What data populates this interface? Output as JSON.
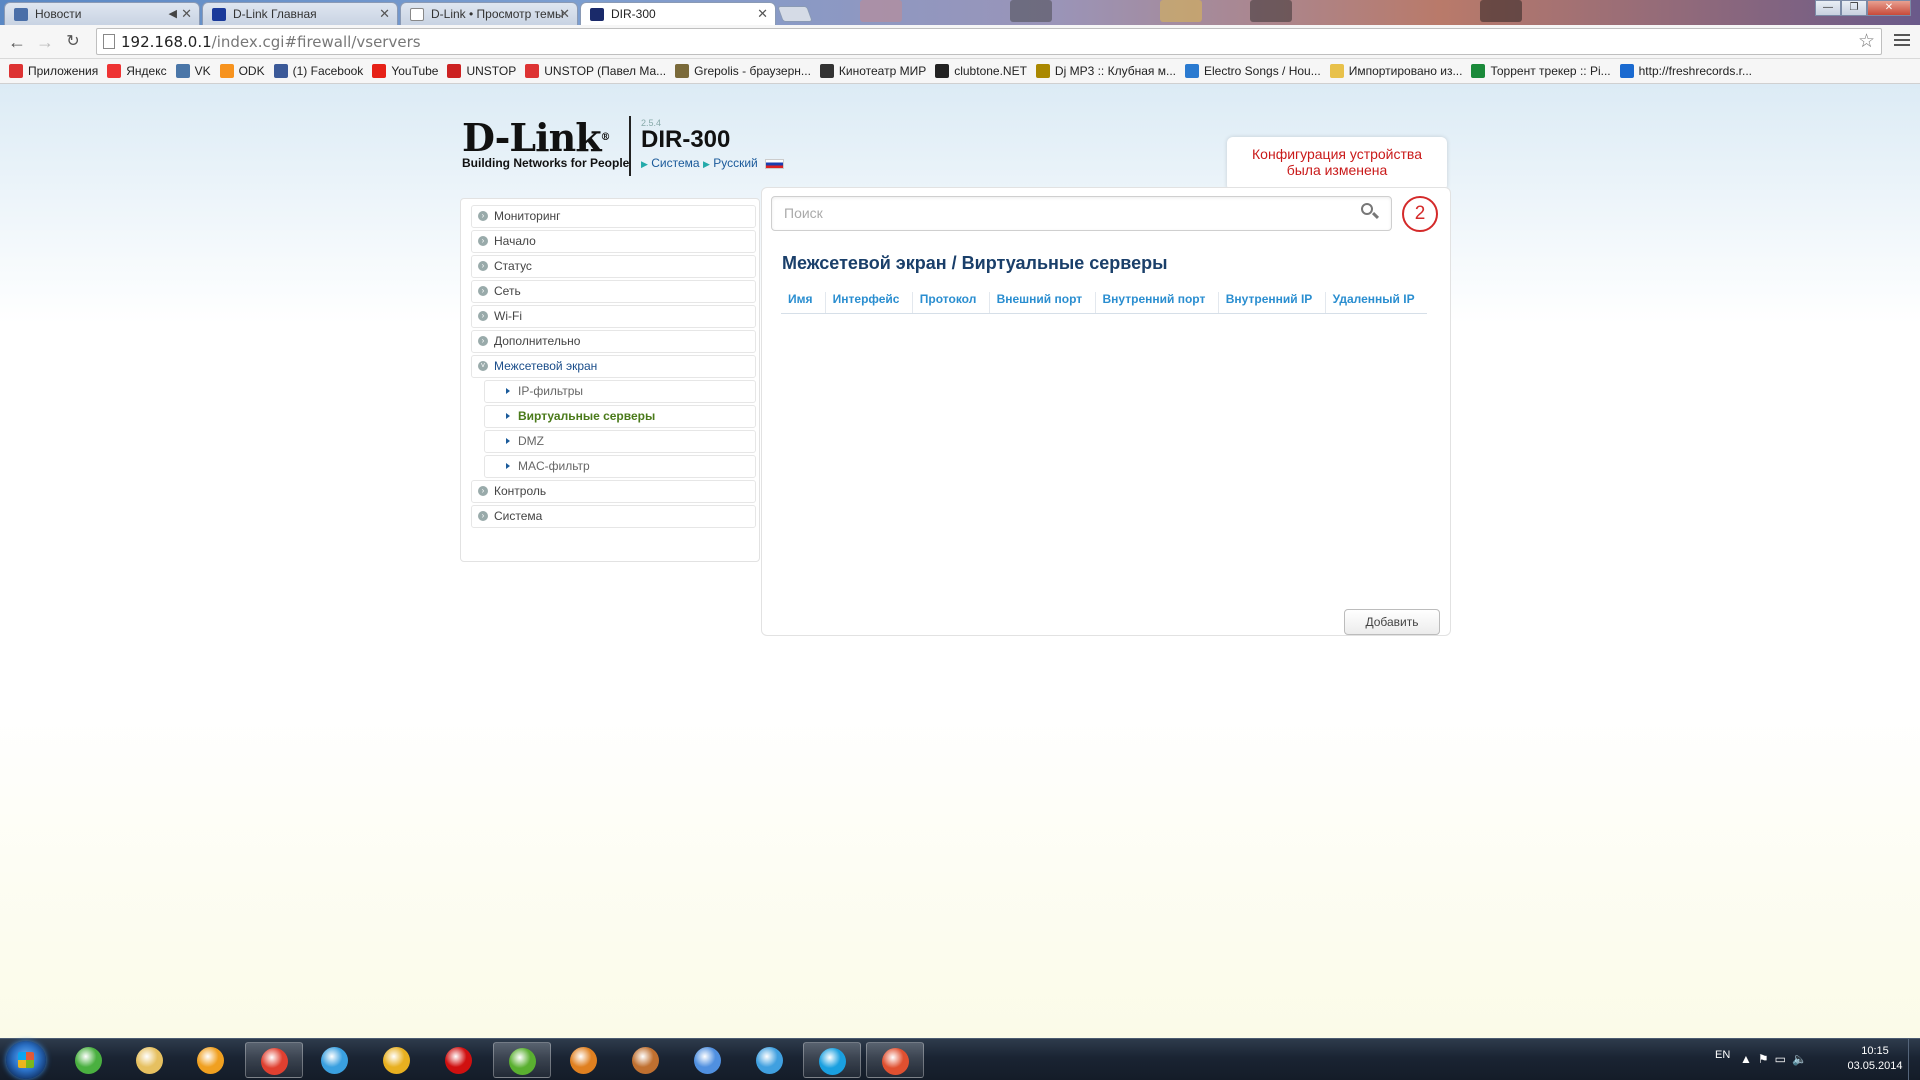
{
  "browser": {
    "tabs": [
      {
        "title": "Новости",
        "muted": true,
        "active": false
      },
      {
        "title": "D-Link Главная",
        "active": false
      },
      {
        "title": "D-Link • Просмотр темы",
        "active": false
      },
      {
        "title": "DIR-300",
        "active": true
      }
    ],
    "window_controls": [
      "—",
      "❐",
      "✕"
    ],
    "url_host": "192.168.0.1",
    "url_path": "/index.cgi#firewall/vservers",
    "bookmarks": [
      {
        "label": "Приложения",
        "icon": "apps-grid-icon",
        "color": "#d33"
      },
      {
        "label": "Яндекс",
        "icon": "yandex-icon",
        "color": "#e33"
      },
      {
        "label": "VK",
        "icon": "vk-icon",
        "color": "#4a76a8"
      },
      {
        "label": "ODK",
        "icon": "odnoklassniki-icon",
        "color": "#f7931e"
      },
      {
        "label": "(1) Facebook",
        "icon": "facebook-icon",
        "color": "#3b5998"
      },
      {
        "label": "YouTube",
        "icon": "youtube-icon",
        "color": "#e62117"
      },
      {
        "label": "UNSTOP",
        "icon": "unstop-icon",
        "color": "#c22"
      },
      {
        "label": "UNSTOP (Павел Ма...",
        "icon": "unstop-s-icon",
        "color": "#d33"
      },
      {
        "label": "Grepolis - браузерн...",
        "icon": "grepolis-icon",
        "color": "#7a6a3a"
      },
      {
        "label": "Кинотеатр МИР",
        "icon": "cinema-icon",
        "color": "#333"
      },
      {
        "label": "clubtone.NET",
        "icon": "clubtone-icon",
        "color": "#222"
      },
      {
        "label": "Dj MP3 :: Клубная м...",
        "icon": "djmp3-icon",
        "color": "#a80"
      },
      {
        "label": "Electro Songs / Hou...",
        "icon": "electro-icon",
        "color": "#2a7ad0"
      },
      {
        "label": "Импортировано из...",
        "icon": "folder-icon",
        "color": "#e8c14a"
      },
      {
        "label": "Торрент трекер :: Pi...",
        "icon": "torrent-icon",
        "color": "#1a8a3a"
      },
      {
        "label": "http://freshrecords.r...",
        "icon": "ie-icon",
        "color": "#1a6ad0"
      }
    ]
  },
  "header": {
    "brand": "D-Link",
    "tagline": "Building Networks for People",
    "firmware": "2.5.4",
    "model": "DIR-300",
    "link_system": "Система",
    "link_language": "Русский"
  },
  "notice": {
    "line1": "Конфигурация устройства",
    "line2": "была изменена",
    "count": "2"
  },
  "search": {
    "placeholder": "Поиск"
  },
  "sidebar": {
    "items": [
      {
        "label": "Мониторинг",
        "type": "top"
      },
      {
        "label": "Начало",
        "type": "top"
      },
      {
        "label": "Статус",
        "type": "top"
      },
      {
        "label": "Сеть",
        "type": "top"
      },
      {
        "label": "Wi-Fi",
        "type": "top"
      },
      {
        "label": "Дополнительно",
        "type": "top"
      },
      {
        "label": "Межсетевой экран",
        "type": "open"
      },
      {
        "label": "IP-фильтры",
        "type": "sub"
      },
      {
        "label": "Виртуальные серверы",
        "type": "sub-active"
      },
      {
        "label": "DMZ",
        "type": "sub"
      },
      {
        "label": "MAC-фильтр",
        "type": "sub"
      },
      {
        "label": "Контроль",
        "type": "top"
      },
      {
        "label": "Система",
        "type": "top"
      }
    ]
  },
  "main": {
    "breadcrumb_parent": "Межсетевой экран",
    "breadcrumb_sep": "/",
    "title": "Виртуальные серверы",
    "columns": [
      "Имя",
      "Интерфейс",
      "Протокол",
      "Внешний порт",
      "Внутренний порт",
      "Внутренний IP",
      "Удаленный IP"
    ],
    "rows": [],
    "add_button": "Добавить"
  },
  "taskbar": {
    "apps": [
      {
        "name": "butterfly-app-icon",
        "color": "#4ab040",
        "active": false
      },
      {
        "name": "explorer-folder-icon",
        "color": "#e6c060",
        "active": false
      },
      {
        "name": "aimp-icon",
        "color": "#f0a020",
        "active": false
      },
      {
        "name": "chrome-icon",
        "color": "#e04030",
        "active": true
      },
      {
        "name": "music-player-icon",
        "color": "#3aa0e0",
        "active": false
      },
      {
        "name": "winamp-icon",
        "color": "#e8b020",
        "active": false
      },
      {
        "name": "opera-icon",
        "color": "#d01010",
        "active": false
      },
      {
        "name": "utorrent-icon",
        "color": "#5ab030",
        "active": true
      },
      {
        "name": "lightning-app-icon",
        "color": "#e08020",
        "active": false
      },
      {
        "name": "lightning-app-2-icon",
        "color": "#c07030",
        "active": false
      },
      {
        "name": "moon-app-icon",
        "color": "#5090e0",
        "active": false
      },
      {
        "name": "itunes-icon",
        "color": "#40a0e0",
        "active": false
      },
      {
        "name": "skype-icon",
        "color": "#1aa0e0",
        "active": true
      },
      {
        "name": "media-app-icon",
        "color": "#e05030",
        "active": true
      }
    ],
    "lang": "EN",
    "time": "10:15",
    "date": "03.05.2014"
  }
}
